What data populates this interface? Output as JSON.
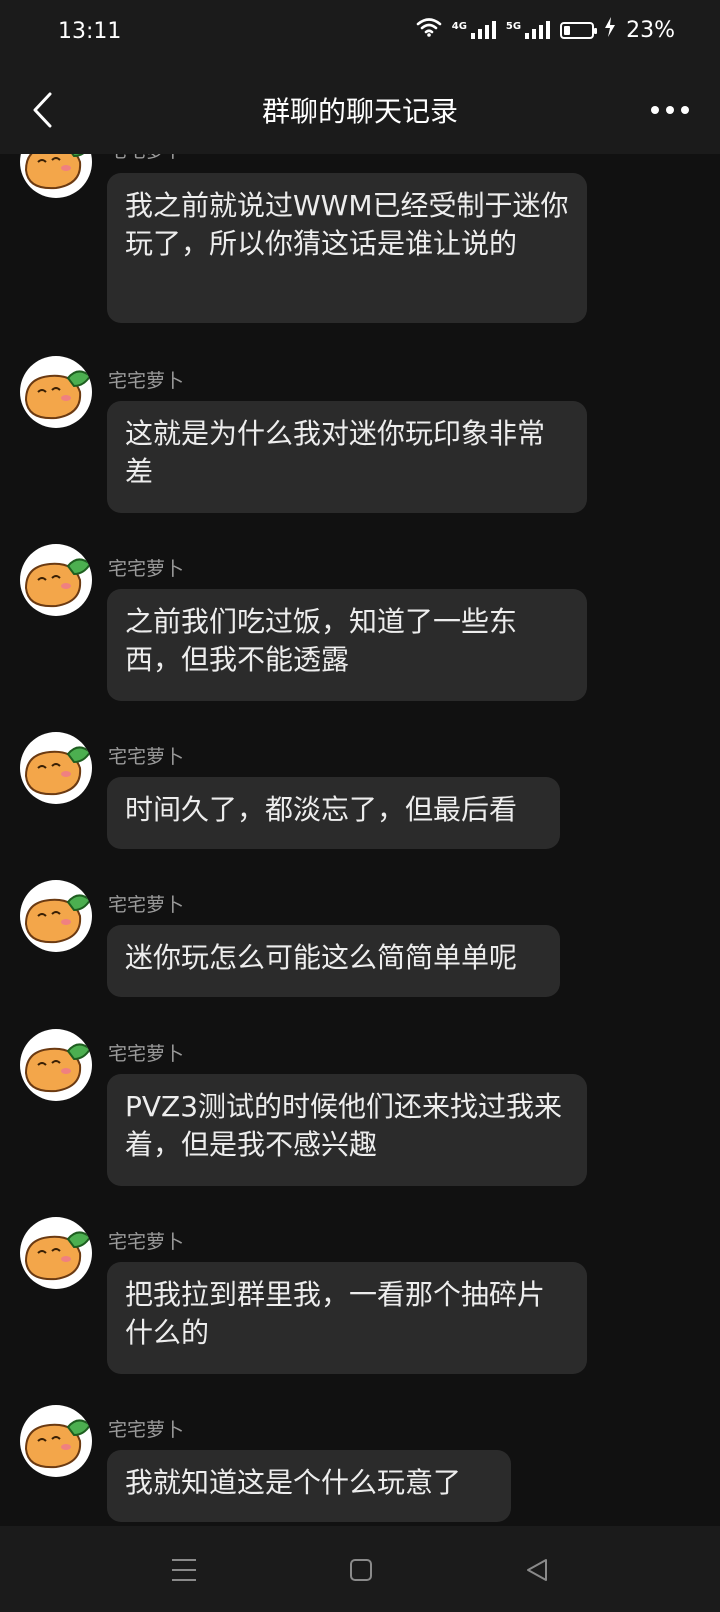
{
  "status_bar": {
    "time": "13:11",
    "network_1": "4G",
    "network_2": "5G",
    "battery": "23%",
    "battery_level": 0.23
  },
  "header": {
    "title": "群聊的聊天记录"
  },
  "messages": [
    {
      "sender": "宅宅萝卜",
      "text": "我之前就说过WWM已经受制于迷你玩了，所以你猜这话是谁让说的"
    },
    {
      "sender": "宅宅萝卜",
      "text": "这就是为什么我对迷你玩印象非常差"
    },
    {
      "sender": "宅宅萝卜",
      "text": "之前我们吃过饭，知道了一些东西，但我不能透露"
    },
    {
      "sender": "宅宅萝卜",
      "text": "时间久了，都淡忘了，但最后看"
    },
    {
      "sender": "宅宅萝卜",
      "text": "迷你玩怎么可能这么简简单单呢"
    },
    {
      "sender": "宅宅萝卜",
      "text": "PVZ3测试的时候他们还来找过我来着，但是我不感兴趣"
    },
    {
      "sender": "宅宅萝卜",
      "text": "把我拉到群里我，一看那个抽碎片什么的"
    },
    {
      "sender": "宅宅萝卜",
      "text": "我就知道这是个什么玩意了"
    }
  ],
  "colors": {
    "background": "#111111",
    "bar_background": "#1b1b1b",
    "bubble": "#2b2b2b"
  }
}
